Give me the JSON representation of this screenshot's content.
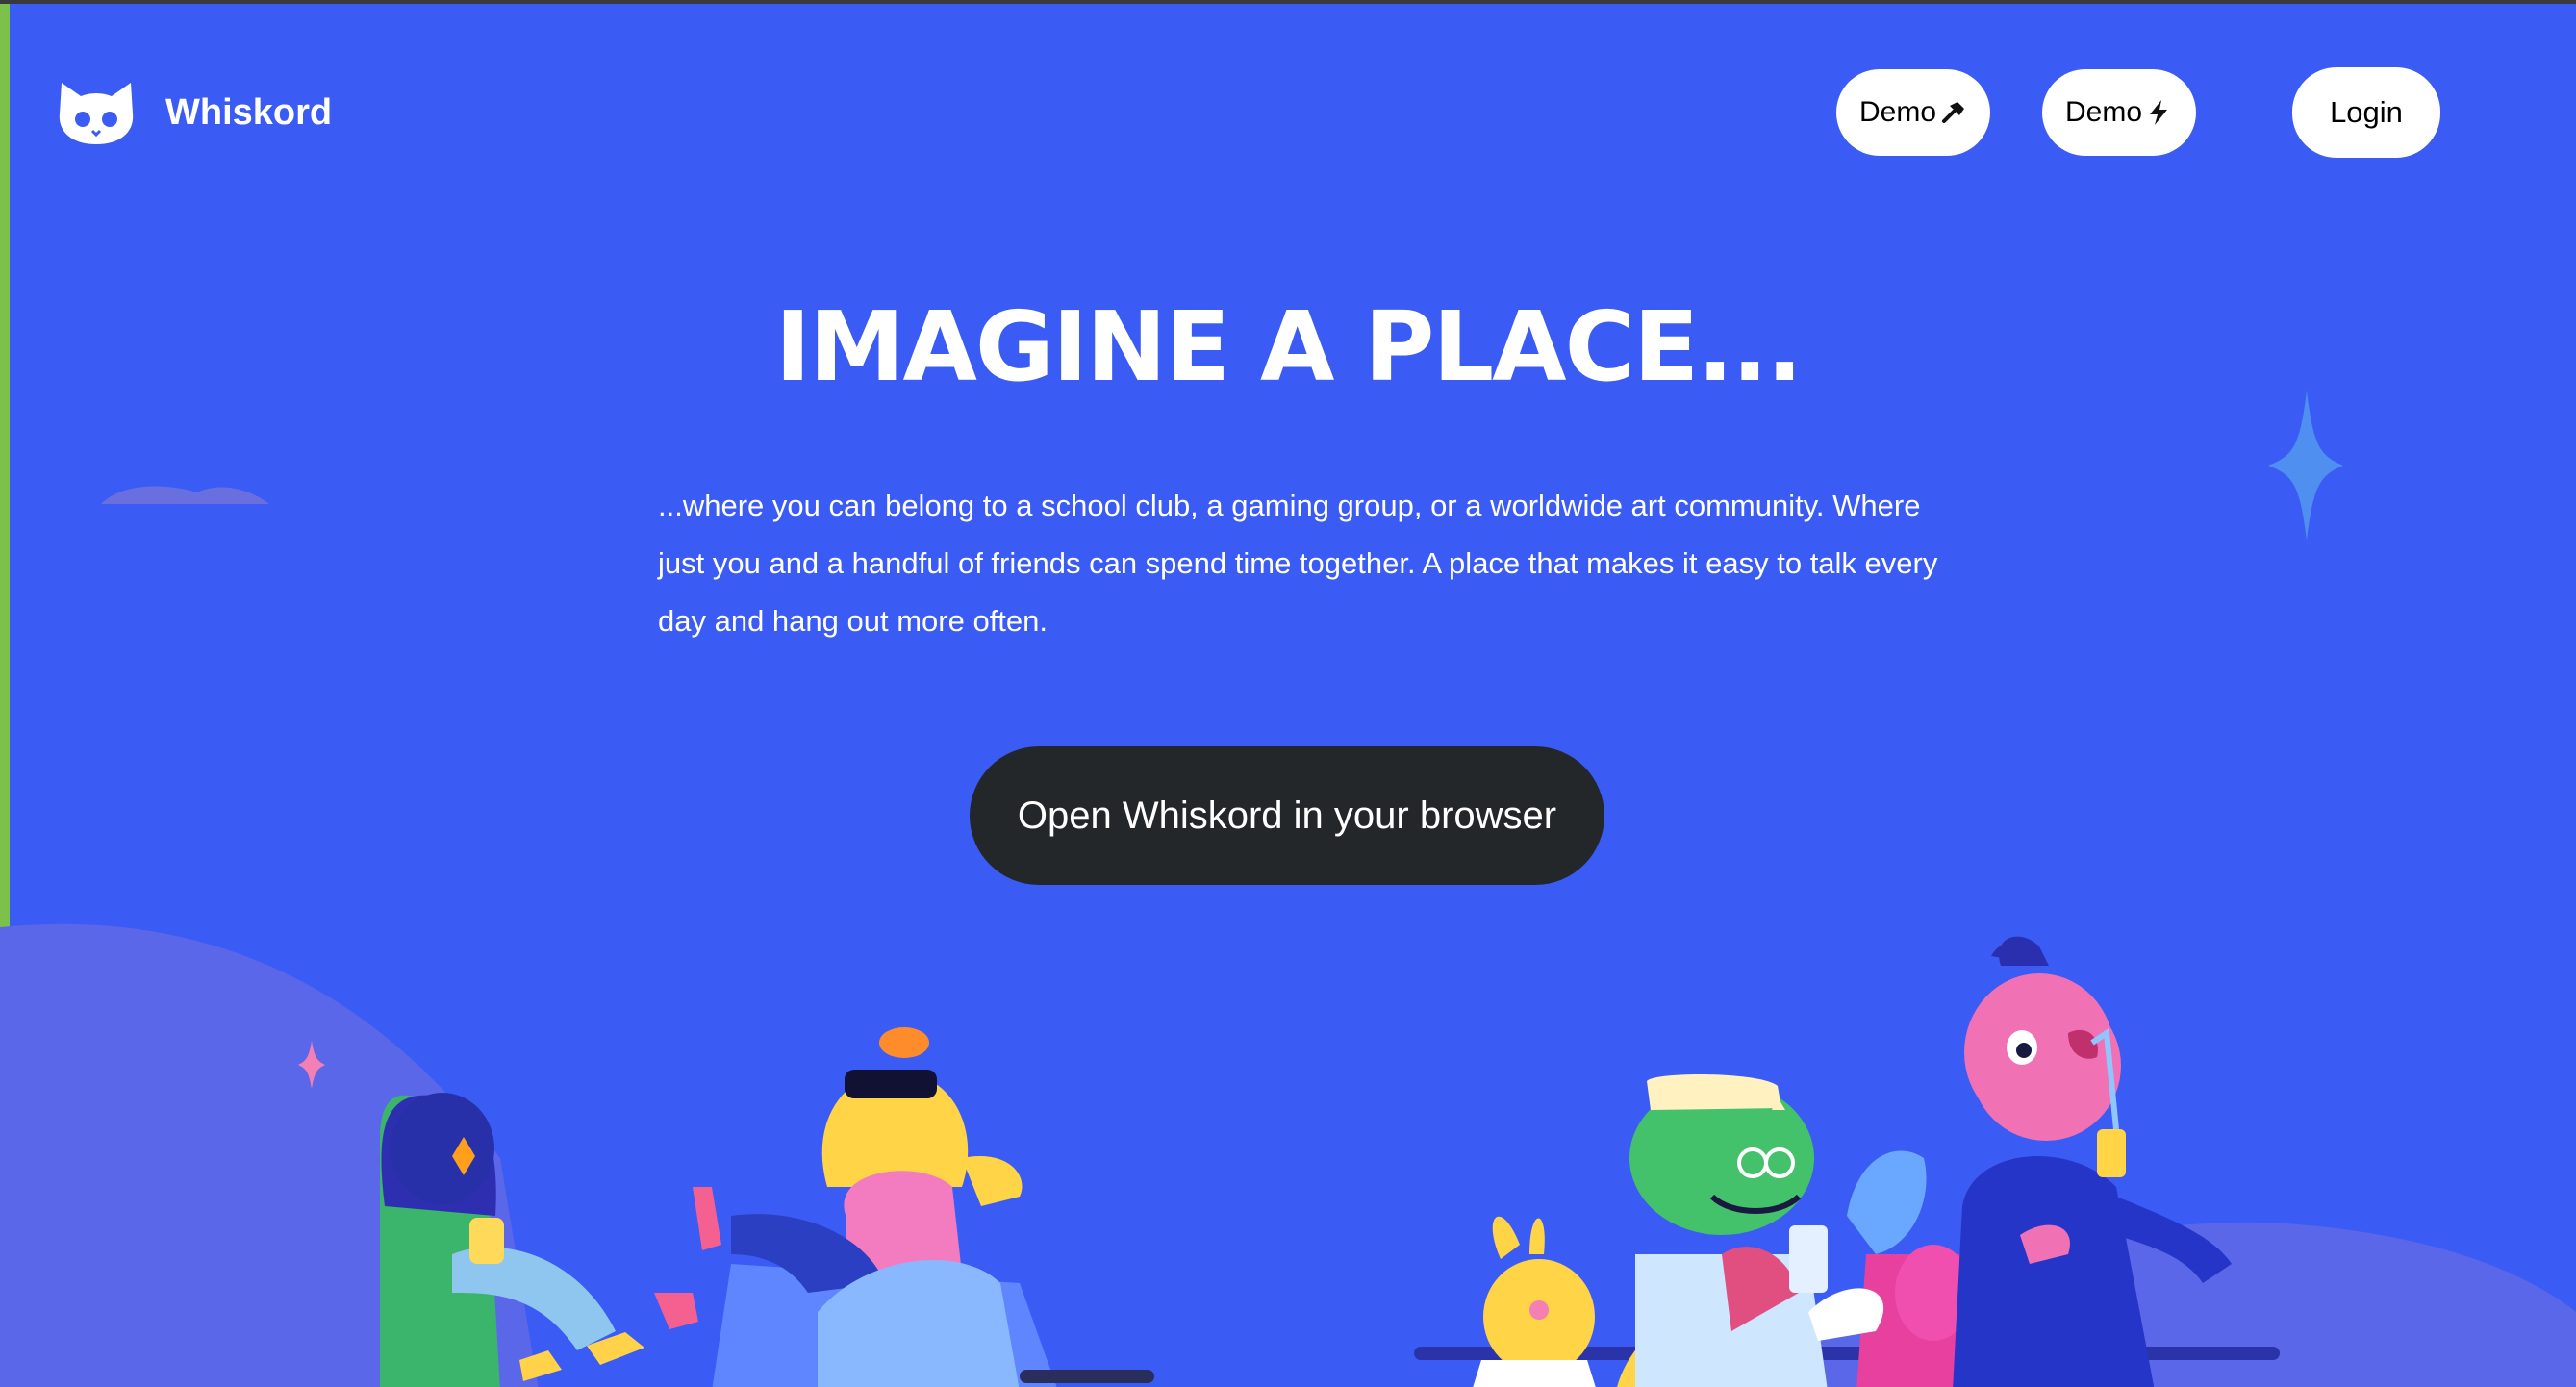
{
  "header": {
    "brand": "Whiskord",
    "nav": [
      {
        "label": "Demo",
        "icon": "hammer-icon"
      },
      {
        "label": "Demo",
        "icon": "lightning-icon"
      }
    ],
    "login_label": "Login"
  },
  "hero": {
    "title": "IMAGINE A PLACE...",
    "description": "...where you can belong to a school club, a gaming group, or a worldwide art community. Where just you and a handful of friends can spend time together. A place that makes it easy to talk every day and hang out more often.",
    "cta_label": "Open Whiskord in your browser"
  },
  "colors": {
    "background": "#3b5bf5",
    "cta_background": "#23272a",
    "button_background": "#ffffff",
    "text": "#ffffff"
  }
}
